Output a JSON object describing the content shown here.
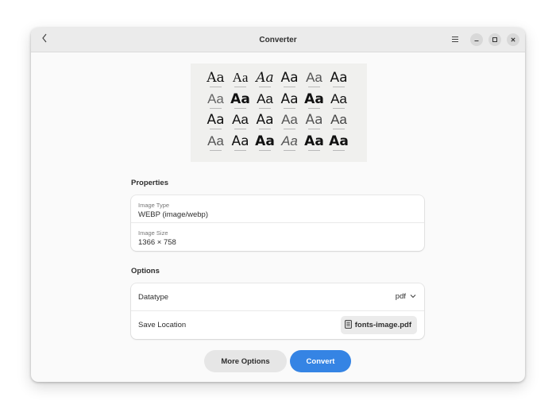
{
  "window": {
    "title": "Converter"
  },
  "preview": {
    "samples": [
      "Aa",
      "Aa",
      "Aa",
      "Aa",
      "Aa",
      "Aa",
      "Aa",
      "Aa",
      "Aa",
      "Aa",
      "Aa",
      "Aa",
      "Aa",
      "Aa",
      "Aa",
      "Aa",
      "Aa",
      "Aa",
      "Aa",
      "Aa",
      "Aa",
      "Aa",
      "Aa",
      "Aa"
    ]
  },
  "properties": {
    "title": "Properties",
    "image_type_label": "Image Type",
    "image_type_value": "WEBP (image/webp)",
    "image_size_label": "Image Size",
    "image_size_value": "1366 × 758"
  },
  "options": {
    "title": "Options",
    "datatype_label": "Datatype",
    "datatype_value": "pdf",
    "save_location_label": "Save Location",
    "save_location_value": "fonts-image.pdf"
  },
  "actions": {
    "more_options": "More Options",
    "convert": "Convert"
  },
  "colors": {
    "accent": "#3584e4",
    "secondary_button": "#e6e6e6"
  }
}
